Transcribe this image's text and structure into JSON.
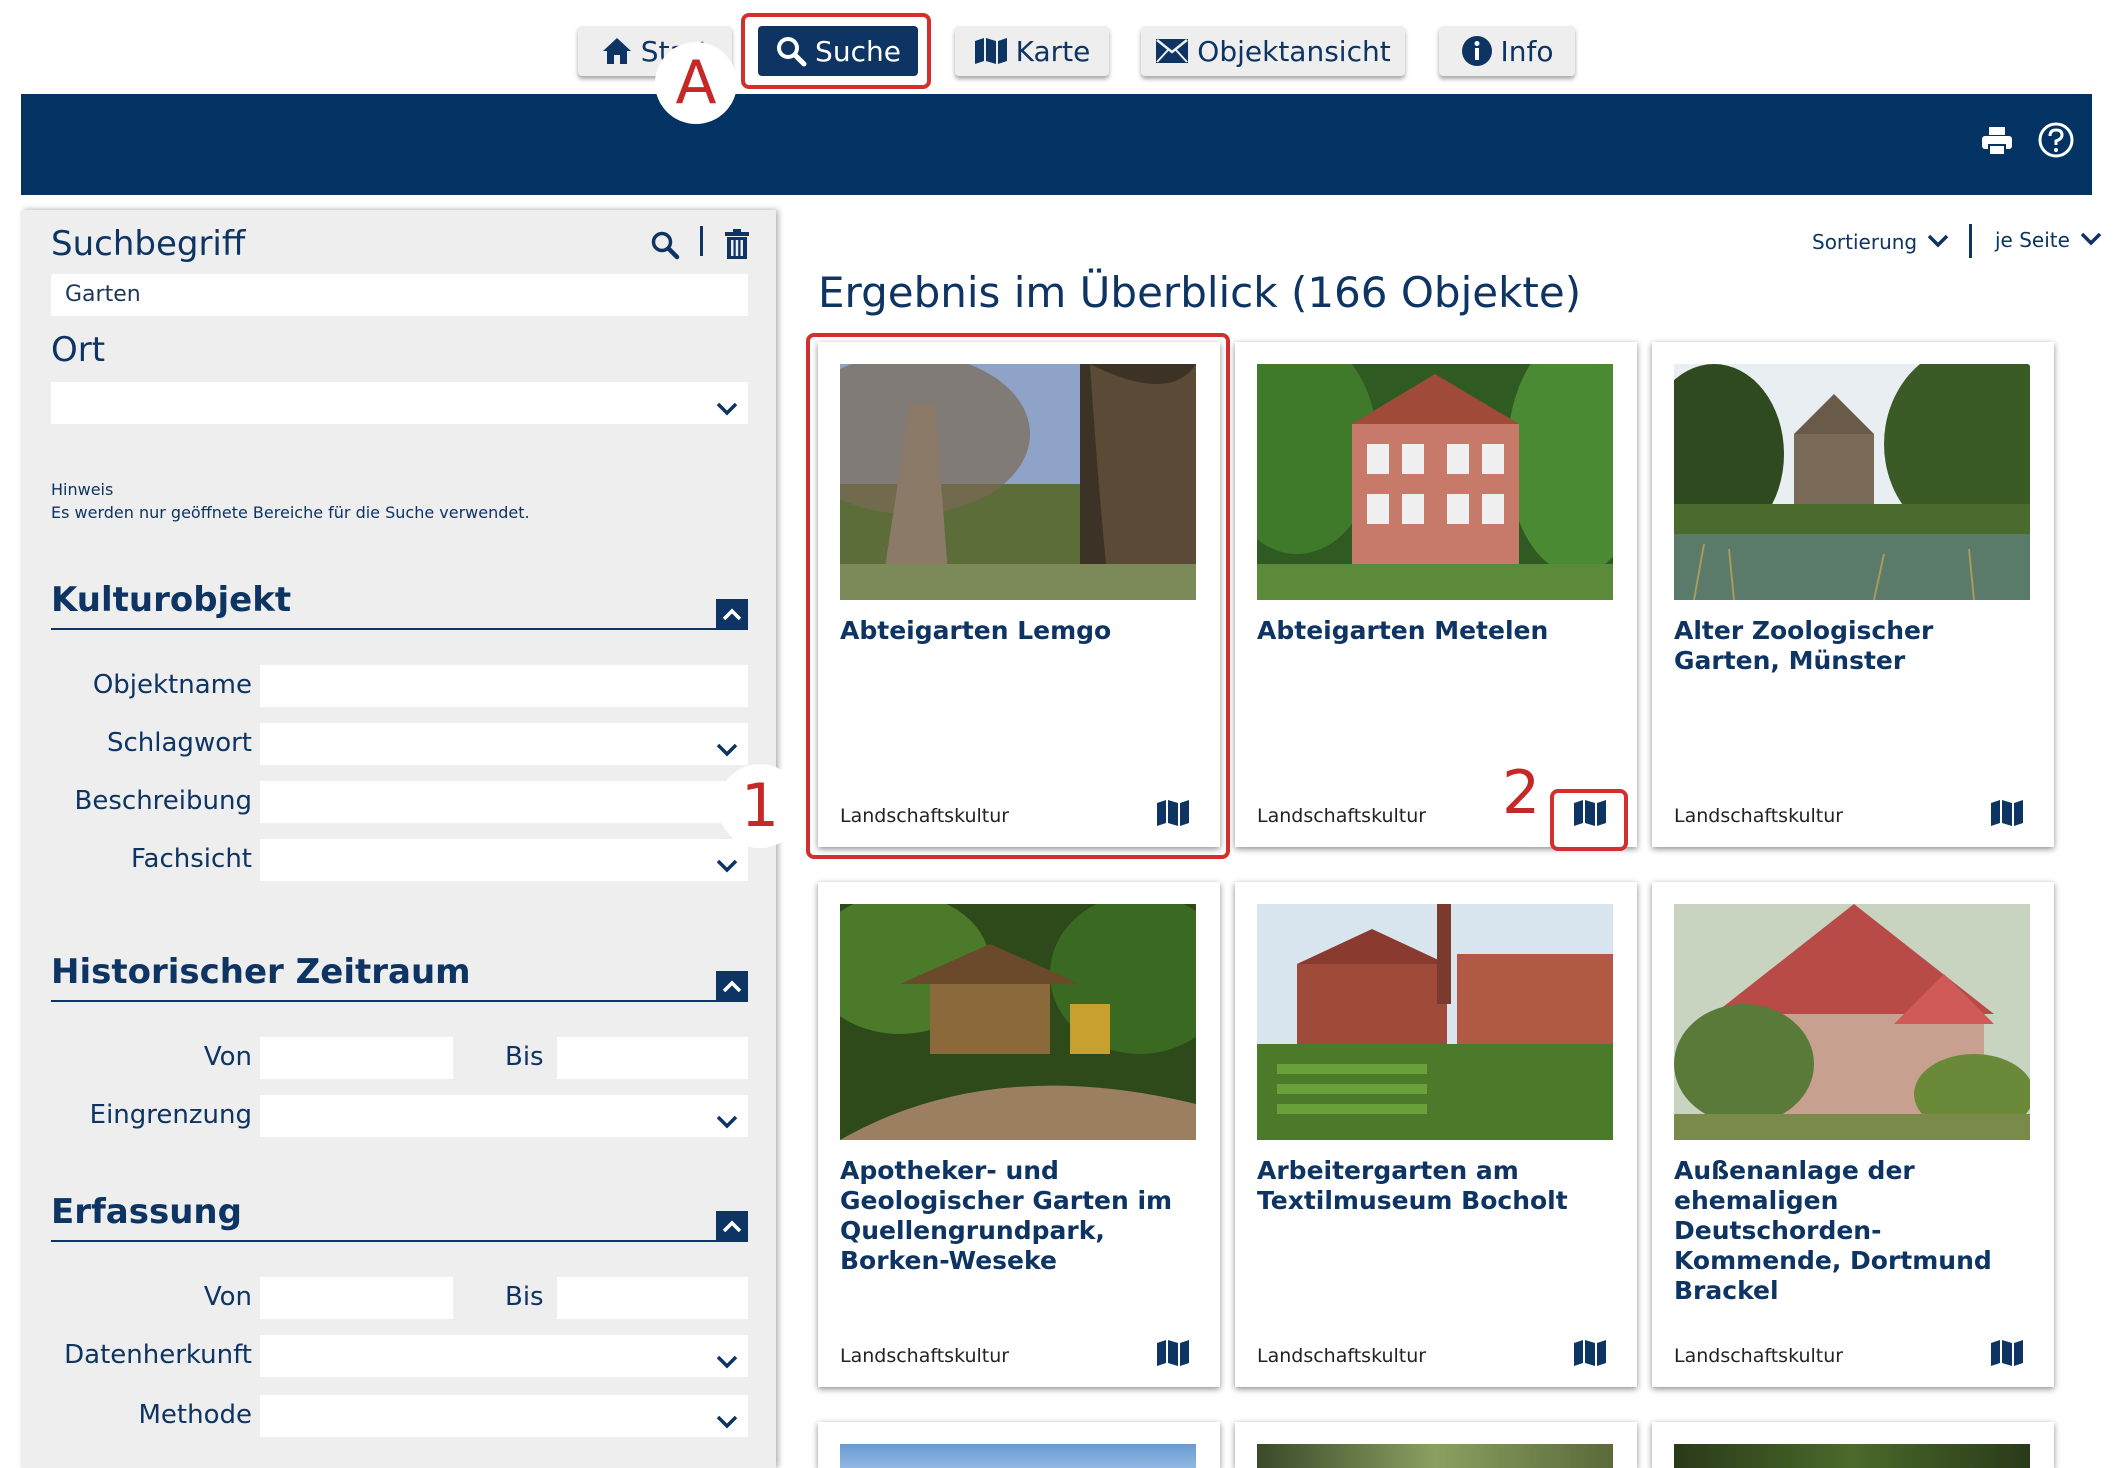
{
  "tabs": [
    {
      "label": "Start",
      "icon": "home-icon"
    },
    {
      "label": "Suche",
      "icon": "search-icon",
      "active": true
    },
    {
      "label": "Karte",
      "icon": "map-icon"
    },
    {
      "label": "Objektansicht",
      "icon": "envelope-icon"
    },
    {
      "label": "Info",
      "icon": "info-icon"
    }
  ],
  "annotations": {
    "a": "A",
    "one": "1",
    "two": "2"
  },
  "header_icons": [
    "print-icon",
    "help-icon"
  ],
  "colors": {
    "brand": "#023362",
    "text": "#0d3462",
    "highlight": "#d32f2f",
    "panel": "#eeeeee"
  },
  "sidebar": {
    "suchbegriff_label": "Suchbegriff",
    "suchbegriff_value": "Garten",
    "ort_label": "Ort",
    "hinweis_title": "Hinweis",
    "hinweis_text": "Es werden nur geöffnete Bereiche für die Suche verwendet.",
    "kulturobjekt": {
      "title": "Kulturobjekt",
      "objektname": "Objektname",
      "schlagwort": "Schlagwort",
      "beschreibung": "Beschreibung",
      "fachsicht": "Fachsicht"
    },
    "zeitraum": {
      "title": "Historischer Zeitraum",
      "von": "Von",
      "bis": "Bis",
      "eingrenzung": "Eingrenzung"
    },
    "erfassung": {
      "title": "Erfassung",
      "von": "Von",
      "bis": "Bis",
      "datenherkunft": "Datenherkunft",
      "methode": "Methode"
    }
  },
  "main": {
    "sortierung": "Sortierung",
    "je_seite": "je Seite",
    "result_title": "Ergebnis im Überblick (166 Objekte)",
    "cards": [
      {
        "title": "Abteigarten Lemgo",
        "category": "Landschaftskultur"
      },
      {
        "title": "Abteigarten Metelen",
        "category": "Landschaftskultur"
      },
      {
        "title": "Alter Zoologischer Garten, Münster",
        "category": "Landschaftskultur"
      },
      {
        "title": "Apotheker- und Geologischer Garten im Quellengrundpark, Borken-Weseke",
        "category": "Landschaftskultur"
      },
      {
        "title": "Arbeitergarten am Textilmuseum Bocholt",
        "category": "Landschaftskultur"
      },
      {
        "title": "Außenanlage der ehemaligen Deutschorden-Kommende, Dortmund Brackel",
        "category": "Landschaftskultur"
      }
    ]
  }
}
